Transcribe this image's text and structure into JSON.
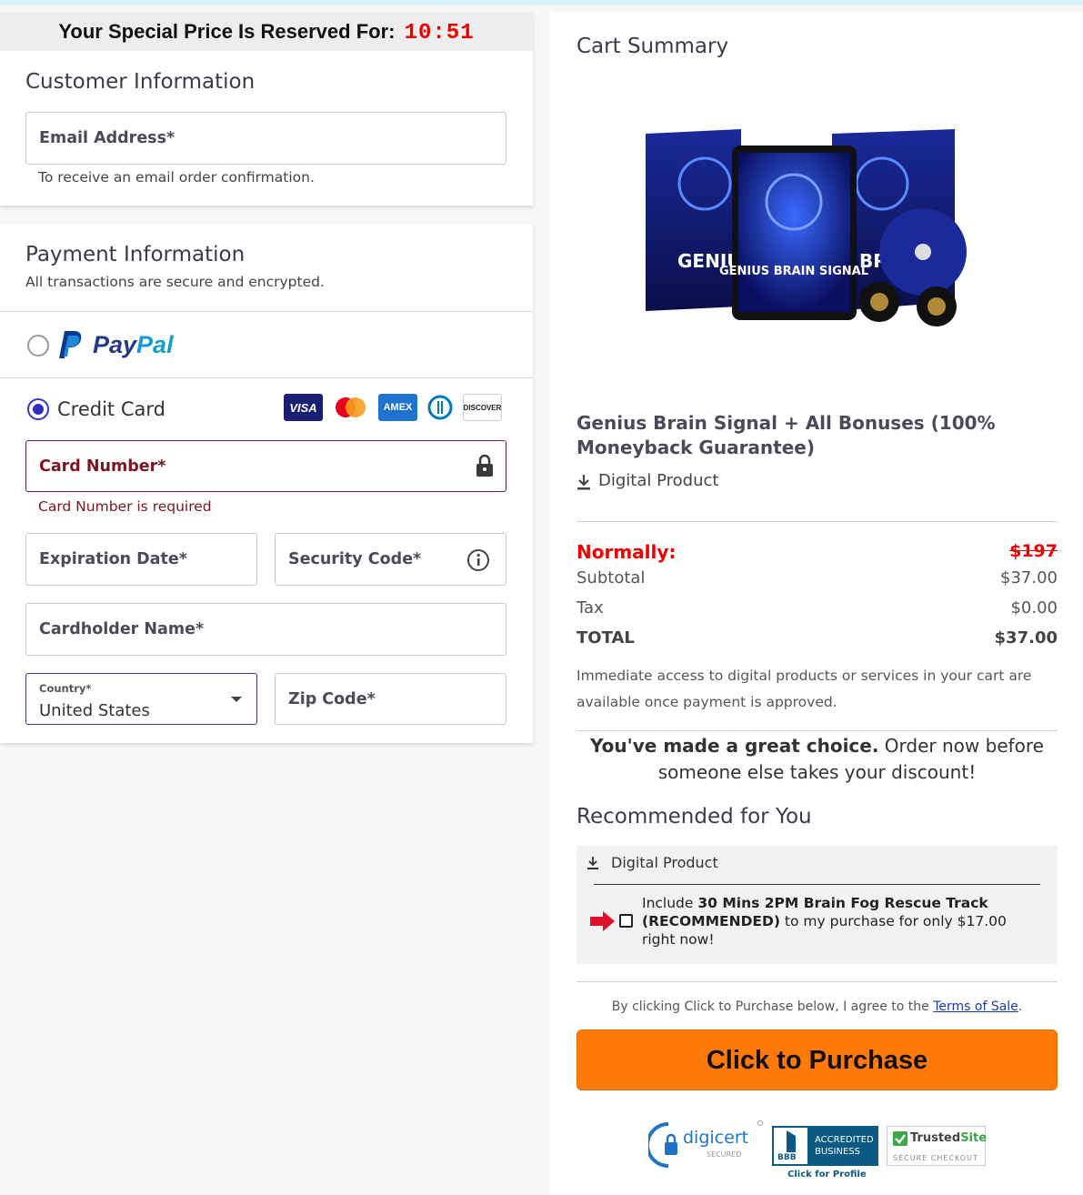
{
  "timer": {
    "label": "Your Special Price Is Reserved For:",
    "time": "10:51"
  },
  "customer": {
    "title": "Customer Information",
    "email_label": "Email Address*",
    "email_hint": "To receive an email order confirmation."
  },
  "payment": {
    "title": "Payment Information",
    "subtitle": "All transactions are secure and encrypted.",
    "paypal_label_pay": "Pay",
    "paypal_label_pal": "Pal",
    "credit_card_label": "Credit Card",
    "card_logos": [
      "VISA",
      "mastercard",
      "AMEX",
      "Diners",
      "DISCOVER"
    ],
    "card_number_label": "Card Number*",
    "card_number_error": "Card Number is required",
    "expiration_label": "Expiration Date*",
    "security_label": "Security Code*",
    "cardholder_label": "Cardholder Name*",
    "country_label": "Country*",
    "country_value": "United States",
    "zip_label": "Zip Code*"
  },
  "summary": {
    "title": "Cart Summary",
    "product_image_words": {
      "left_box": "GENIUS",
      "tablet": "GENIUS BRAIN SIGNAL",
      "right_box": "BRA"
    },
    "product_name": "Genius Brain Signal + All Bonuses (100% Moneyback Guarantee)",
    "product_type": "Digital Product",
    "normally_label": "Normally:",
    "normally_price": "$197",
    "subtotal_label": "Subtotal",
    "subtotal_value": "$37.00",
    "tax_label": "Tax",
    "tax_value": "$0.00",
    "total_label": "TOTAL",
    "total_value": "$37.00",
    "access_note": "Immediate access to digital products or services in your cart are available once payment is approved.",
    "choice_bold": "You've made a great choice.",
    "choice_rest_1": "Order now before",
    "choice_rest_2": "someone else takes your discount!",
    "recommended_title": "Recommended for You",
    "rec_type": "Digital Product",
    "rec_text_prefix": "Include",
    "rec_text_bold": "30 Mins 2PM Brain Fog Rescue Track (RECOMMENDED)",
    "rec_text_suffix": "to my purchase for only $17.00 right now!",
    "terms_prefix": "By clicking Click to Purchase below, I agree to the",
    "terms_link": "Terms of Sale",
    "terms_suffix": ".",
    "purchase_button": "Click to Purchase",
    "badges": {
      "digicert": "digicert",
      "digicert_sub": "SECURED",
      "bbb_line1": "ACCREDITED",
      "bbb_line2": "BUSINESS",
      "bbb_mark": "BBB",
      "bbb_profile": "Click for Profile",
      "trusted_a": "Trusted",
      "trusted_b": "Site",
      "trusted_sub": "SECURE CHECKOUT"
    }
  },
  "colors": {
    "accent": "#2f2fc4",
    "error": "#7a1522",
    "purchase": "#ff7a0a",
    "red": "#e00000"
  }
}
